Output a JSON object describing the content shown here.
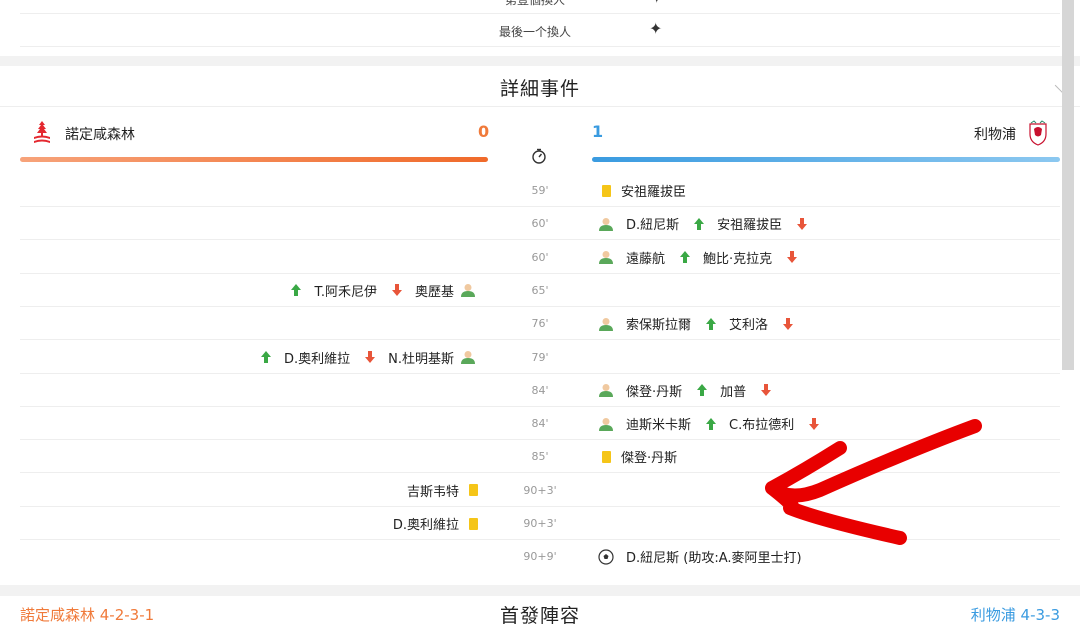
{
  "stats_top": {
    "rows": [
      {
        "label": "第壹個換人",
        "icon": "sparkle-icon"
      },
      {
        "label": "最後一个換人",
        "icon": "sparkle-icon"
      }
    ]
  },
  "details": {
    "title": "詳細事件",
    "home": {
      "name": "諾定咸森林",
      "score": "0",
      "color": "#f07a3a"
    },
    "away": {
      "name": "利物浦",
      "score": "1",
      "color": "#3a9be0"
    },
    "events": [
      {
        "minute": "59'",
        "side": "away",
        "type": "yellow-card",
        "player": "安祖羅拔臣"
      },
      {
        "minute": "60'",
        "side": "away",
        "type": "substitution",
        "in": "D.紐尼斯",
        "out": "安祖羅拔臣"
      },
      {
        "minute": "60'",
        "side": "away",
        "type": "substitution",
        "in": "遠藤航",
        "out": "鮑比·克拉克"
      },
      {
        "minute": "65'",
        "side": "home",
        "type": "substitution",
        "in": "T.阿禾尼伊",
        "out": "奧歷基"
      },
      {
        "minute": "76'",
        "side": "away",
        "type": "substitution",
        "in": "索保斯拉爾",
        "out": "艾利洛"
      },
      {
        "minute": "79'",
        "side": "home",
        "type": "substitution",
        "in": "D.奧利維拉",
        "out": "N.杜明基斯"
      },
      {
        "minute": "84'",
        "side": "away",
        "type": "substitution",
        "in": "傑登·丹斯",
        "out": "加普"
      },
      {
        "minute": "84'",
        "side": "away",
        "type": "substitution",
        "in": "迪斯米卡斯",
        "out": "C.布拉德利"
      },
      {
        "minute": "85'",
        "side": "away",
        "type": "yellow-card",
        "player": "傑登·丹斯"
      },
      {
        "minute": "90+3'",
        "side": "home",
        "type": "yellow-card",
        "player": "吉斯韦特"
      },
      {
        "minute": "90+3'",
        "side": "home",
        "type": "yellow-card",
        "player": "D.奧利維拉"
      },
      {
        "minute": "90+9'",
        "side": "away",
        "type": "goal",
        "player": "D.紐尼斯 (助攻:A.麥阿里士打)"
      }
    ]
  },
  "lineup": {
    "title": "首發陣容",
    "home_label": "諾定咸森林 4-2-3-1",
    "away_label": "利物浦 4-3-3"
  },
  "colors": {
    "yellow_card": "#f5c518",
    "arrow_in": "#3aa845",
    "arrow_out": "#e8553a",
    "person": "#5aa85a"
  }
}
